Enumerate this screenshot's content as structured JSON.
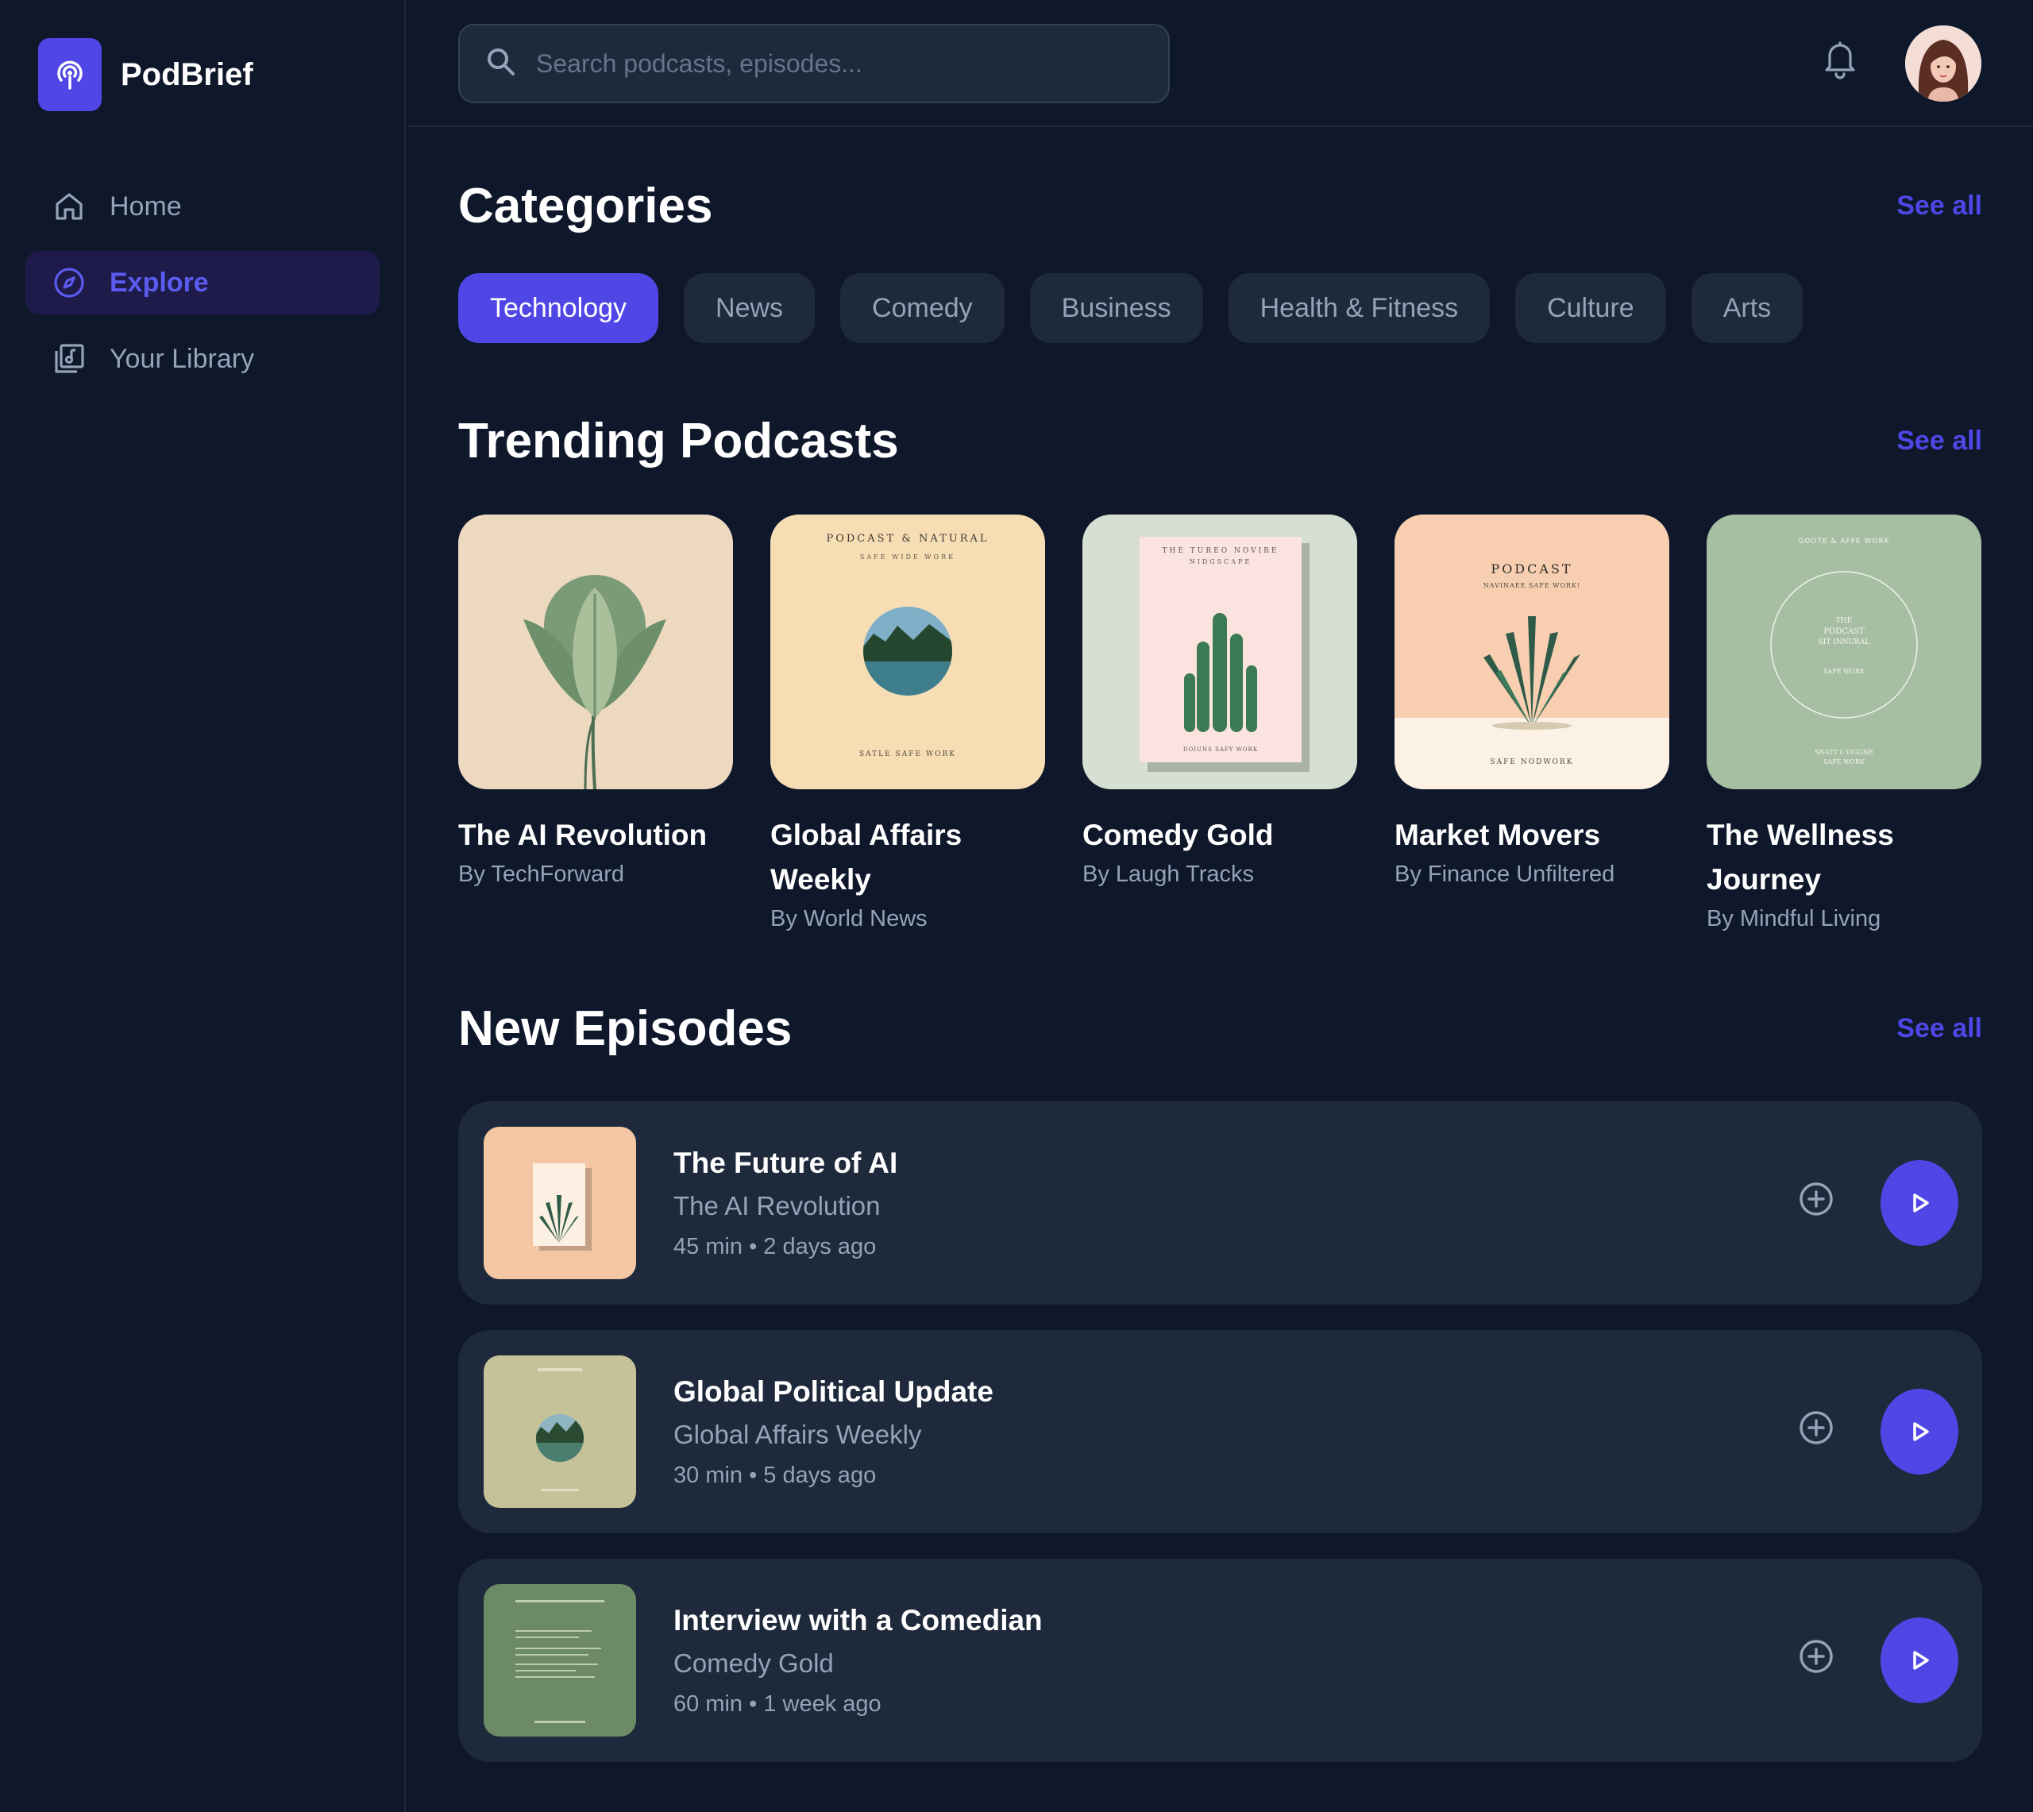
{
  "app": {
    "name": "PodBrief"
  },
  "nav": [
    {
      "label": "Home",
      "icon": "home-icon",
      "active": false
    },
    {
      "label": "Explore",
      "icon": "compass-icon",
      "active": true
    },
    {
      "label": "Your Library",
      "icon": "library-icon",
      "active": false
    }
  ],
  "search": {
    "placeholder": "Search podcasts, episodes..."
  },
  "categories": {
    "title": "Categories",
    "see_all": "See all",
    "items": [
      "Technology",
      "News",
      "Comedy",
      "Business",
      "Health & Fitness",
      "Culture",
      "Arts"
    ],
    "selected": "Technology"
  },
  "trending": {
    "title": "Trending Podcasts",
    "see_all": "See all",
    "items": [
      {
        "title": "The AI Revolution",
        "author": "By TechForward"
      },
      {
        "title": "Global Affairs Weekly",
        "author": "By World News",
        "cover_text": [
          "PODCAST & NATURAL",
          "SAFE WIDE WORK",
          "SATLE SAFE WORK"
        ]
      },
      {
        "title": "Comedy Gold",
        "author": "By Laugh Tracks",
        "cover_text": [
          "THE TUREO NOVIRE",
          "NIDGSCAPE",
          "DOIUNS SAFY WORK"
        ]
      },
      {
        "title": "Market Movers",
        "author": "By Finance Unfiltered",
        "cover_text": [
          "PODCAST",
          "NAVINAEE SAFE WORK!",
          "SAFE NODWORK"
        ]
      },
      {
        "title": "The Wellness Journey",
        "author": "By Mindful Living",
        "cover_text": [
          "GOOTE & AFFE WORK",
          "THE",
          "PODCAST",
          "SIT INNURAL",
          "SAFE WORK",
          "SNATT L VIGGNE",
          "SAFE WORK"
        ]
      }
    ]
  },
  "episodes": {
    "title": "New Episodes",
    "see_all": "See all",
    "items": [
      {
        "title": "The Future of AI",
        "show": "The AI Revolution",
        "meta": "45 min • 2 days ago"
      },
      {
        "title": "Global Political Update",
        "show": "Global Affairs Weekly",
        "meta": "30 min • 5 days ago"
      },
      {
        "title": "Interview with a Comedian",
        "show": "Comedy Gold",
        "meta": "60 min • 1 week ago"
      }
    ]
  },
  "colors": {
    "background": "#0f172a",
    "surface": "#1e293b",
    "accent": "#4f46e5",
    "text_muted": "#94a3b8"
  }
}
